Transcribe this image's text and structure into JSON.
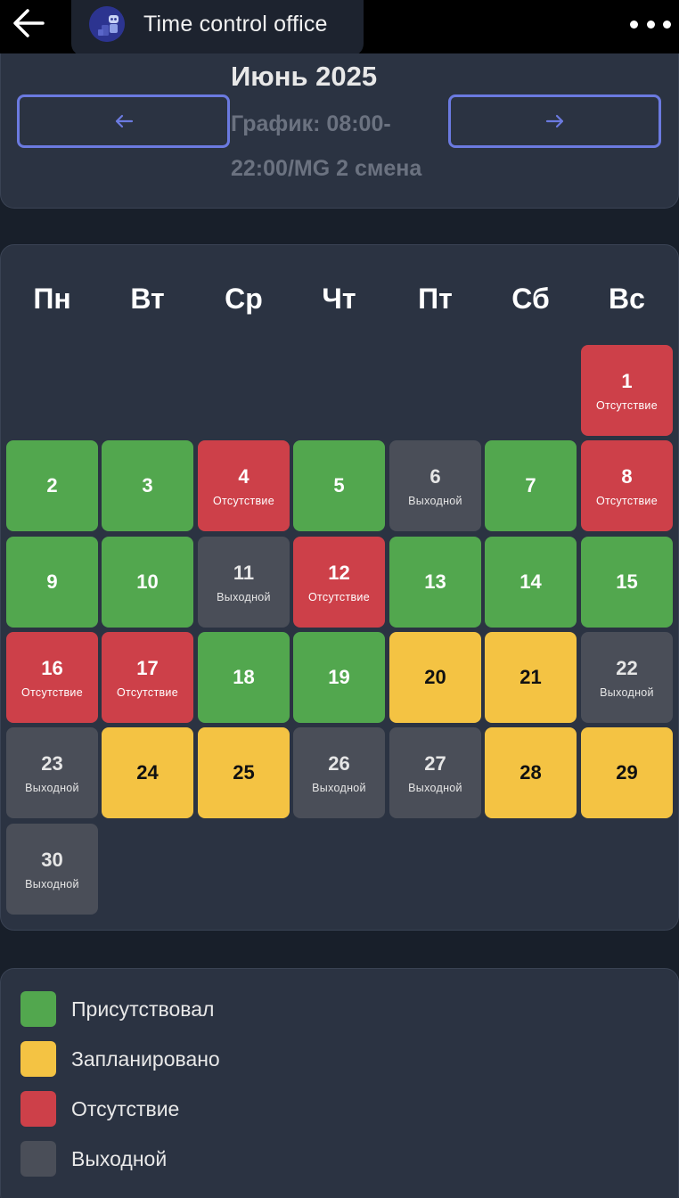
{
  "app": {
    "title": "Time control office"
  },
  "header": {
    "month_title": "Июнь 2025",
    "schedule": "График: 08:00-22:00/MG 2 смена",
    "prev_label": "←",
    "next_label": "→"
  },
  "calendar": {
    "weekdays": [
      "Пн",
      "Вт",
      "Ср",
      "Чт",
      "Пт",
      "Сб",
      "Вс"
    ],
    "days": [
      {
        "num": "1",
        "label": "Отсутствие",
        "status": "absent"
      },
      {
        "num": "2",
        "label": "",
        "status": "present"
      },
      {
        "num": "3",
        "label": "",
        "status": "present"
      },
      {
        "num": "4",
        "label": "Отсутствие",
        "status": "absent"
      },
      {
        "num": "5",
        "label": "",
        "status": "present"
      },
      {
        "num": "6",
        "label": "Выходной",
        "status": "dayoff"
      },
      {
        "num": "7",
        "label": "",
        "status": "present"
      },
      {
        "num": "8",
        "label": "Отсутствие",
        "status": "absent"
      },
      {
        "num": "9",
        "label": "",
        "status": "present"
      },
      {
        "num": "10",
        "label": "",
        "status": "present"
      },
      {
        "num": "11",
        "label": "Выходной",
        "status": "dayoff"
      },
      {
        "num": "12",
        "label": "Отсутствие",
        "status": "absent"
      },
      {
        "num": "13",
        "label": "",
        "status": "present"
      },
      {
        "num": "14",
        "label": "",
        "status": "present"
      },
      {
        "num": "15",
        "label": "",
        "status": "present"
      },
      {
        "num": "16",
        "label": "Отсутствие",
        "status": "absent"
      },
      {
        "num": "17",
        "label": "Отсутствие",
        "status": "absent"
      },
      {
        "num": "18",
        "label": "",
        "status": "present"
      },
      {
        "num": "19",
        "label": "",
        "status": "present"
      },
      {
        "num": "20",
        "label": "",
        "status": "planned"
      },
      {
        "num": "21",
        "label": "",
        "status": "planned"
      },
      {
        "num": "22",
        "label": "Выходной",
        "status": "dayoff"
      },
      {
        "num": "23",
        "label": "Выходной",
        "status": "dayoff"
      },
      {
        "num": "24",
        "label": "",
        "status": "planned"
      },
      {
        "num": "25",
        "label": "",
        "status": "planned"
      },
      {
        "num": "26",
        "label": "Выходной",
        "status": "dayoff"
      },
      {
        "num": "27",
        "label": "Выходной",
        "status": "dayoff"
      },
      {
        "num": "28",
        "label": "",
        "status": "planned"
      },
      {
        "num": "29",
        "label": "",
        "status": "planned"
      },
      {
        "num": "30",
        "label": "Выходной",
        "status": "dayoff"
      }
    ]
  },
  "legend": {
    "items": [
      {
        "label": "Присутствовал",
        "color": "#52a74e"
      },
      {
        "label": "Запланировано",
        "color": "#f4c343"
      },
      {
        "label": "Отсутствие",
        "color": "#cd4049"
      },
      {
        "label": "Выходной",
        "color": "#4a4e58"
      }
    ]
  },
  "colors": {
    "present": "#52a74e",
    "absent": "#cd4049",
    "planned": "#f4c343",
    "dayoff": "#4a4e58",
    "accent": "#6b7ae0"
  }
}
